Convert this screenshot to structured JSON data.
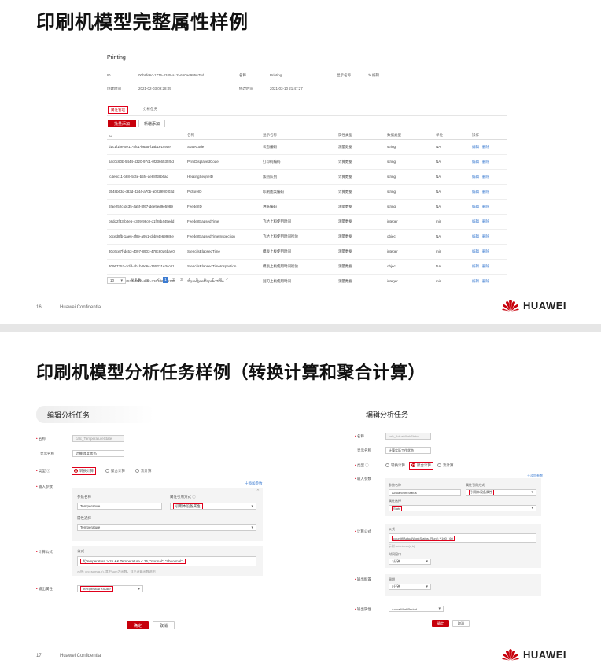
{
  "slide1": {
    "title": "印刷机模型完整属性样例",
    "app_name": "Printing",
    "info": [
      {
        "label": "ID",
        "value": "00b8fe6c-1776-4345-a12f-660ae985675d"
      },
      {
        "label": "名称",
        "value": "Printing"
      },
      {
        "label": "显示名称",
        "value": "编辑"
      },
      {
        "label": "创建时间",
        "value": "2021-02-03 09:28:05"
      },
      {
        "label": "修改时间",
        "value": "2021-03-10 21:47:27"
      }
    ],
    "tabs": [
      "属性管理",
      "分析任务"
    ],
    "buttons": {
      "add": "批量添加",
      "add_one": "新增添加"
    },
    "table": {
      "headers": [
        "ID",
        "名称",
        "显示名称",
        "属性类型",
        "数据类型",
        "单位",
        "操作"
      ],
      "rows": [
        [
          "d1c1f1be-5e11-4fc1-b6a5-f1ab1e1c9ae",
          "StateCode",
          "状态编码",
          "测量数据",
          "string",
          "NA"
        ],
        [
          "5ac0c60b-5444-4320-97c1-0f2366535f0d",
          "PrintDisplayedCode",
          "打印码编码",
          "计算数据",
          "string",
          "NA"
        ],
        [
          "fc4e6c11-b88-4c4e-b5fc-ae88fd8b6ad",
          "HeatingSeqneID",
          "加热队列",
          "计算数据",
          "string",
          "NA"
        ],
        [
          "d548b63d-c83d-4244-a70b-a0229f00f03d",
          "PictureID",
          "印刷图案编码",
          "计算数据",
          "string",
          "NA"
        ],
        [
          "6fae252c-dc35-4a5f-8f67-dee9ed9e5989",
          "FeederID",
          "进纸编码",
          "测量数据",
          "string",
          "NA"
        ],
        [
          "b8dd2f33-b0e6-4309-98c0-d1f28b445edd",
          "FeederElapsedTime",
          "飞达上料使用时间",
          "测量数据",
          "integer",
          "min"
        ],
        [
          "bcced8fb-1ae6-4f8e-a951-cbb94e69988e",
          "FeederElapsedTimeInspection",
          "飞达上料使用时间检验",
          "测量数据",
          "object",
          "NA"
        ],
        [
          "30c6ce7f-dc53-4097-8903-478c60d6bae0",
          "StencilsElapsedTime",
          "模板上板使用时间",
          "测量数据",
          "integer",
          "min"
        ],
        [
          "30967352-dcfd-4b1b-9c6c-365231e3cc01",
          "StencilsElapsedTimeInspection",
          "模板上板使用时间检验",
          "测量数据",
          "object",
          "NA"
        ],
        [
          "8d21005e-4527-4602-8f0c-7262d6206109",
          "SqueegeeElapsedTime",
          "刮刀上板使用时间",
          "测量数据",
          "integer",
          "min"
        ]
      ],
      "op_edit": "编辑",
      "op_delete": "删除"
    },
    "pagination": {
      "page_size": "10",
      "total": "总条数：72",
      "pages": [
        "1",
        "2",
        "3",
        "4",
        "5",
        "6",
        "7",
        "8"
      ],
      "next": ">",
      "prev": "<"
    },
    "page_number": "16",
    "confidential": "Huawei Confidential",
    "logo": "HUAWEI"
  },
  "slide2": {
    "title": "印刷机模型分析任务样例（转换计算和聚合计算）",
    "left": {
      "header": "编辑分析任务",
      "name_label": "名称",
      "name_value": "calc_TemperatureState",
      "display_label": "显示名称",
      "display_value": "计算温度状态",
      "type_label": "类型",
      "types": [
        "转换计算",
        "聚合计算",
        "流计算"
      ],
      "input_label": "输入参数",
      "add_param": "十添加参数",
      "param_name_label": "参数名称",
      "param_name_value": "Temperature",
      "attr_type_label": "属性引用方式",
      "attr_type_value": "引用本设备属性",
      "attr_select_label": "属性选择",
      "attr_select_value": "Temperature",
      "formula_label": "计算公式",
      "formula_title": "公式",
      "formula_value": "if(Temperature > 25 && Temperature < 35, \"normal\", \"abnormal\")",
      "formula_hint": "示例: crc=sum(a,b), 其中sum为函数，详见计算函数说明",
      "output_label": "输出属性",
      "output_value": "TemperatureState",
      "confirm": "确定",
      "cancel": "取消"
    },
    "right": {
      "header": "编辑分析任务",
      "name_label": "名称",
      "name_value": "calc_ActualWorkStatus",
      "display_label": "显示名称",
      "display_value": "计算实际工作状态",
      "type_label": "类型",
      "types": [
        "转换计算",
        "聚合计算",
        "流计算"
      ],
      "input_label": "输入参数",
      "add_param": "十添加参数",
      "param_name_label": "参数名称",
      "param_name_value": "ActualWorkStatus",
      "attr_type_label": "属性引用方式",
      "attr_type_value": "引用本设备属性",
      "attr_select_label": "属性选择",
      "attr_select_value": "State",
      "formula_label": "计算公式",
      "formula_title": "公式",
      "formula_value": "countif(ActualWorkStatus,\"Run\") * 100 / 60",
      "formula_hint": "示例: a+b+sum(a,b)",
      "time_window_label": "时间窗口",
      "time_window_value": "1分钟",
      "output_setting_label": "输出配置",
      "period_label": "周期",
      "period_value": "5分钟",
      "output_label": "输出属性",
      "output_value": "ActualWorkPeriod",
      "confirm": "确定",
      "cancel": "取消"
    },
    "page_number": "17",
    "confidential": "Huawei Confidential",
    "logo": "HUAWEI"
  },
  "colors": {
    "accent": "#c7000b",
    "link": "#3b7bd1"
  }
}
